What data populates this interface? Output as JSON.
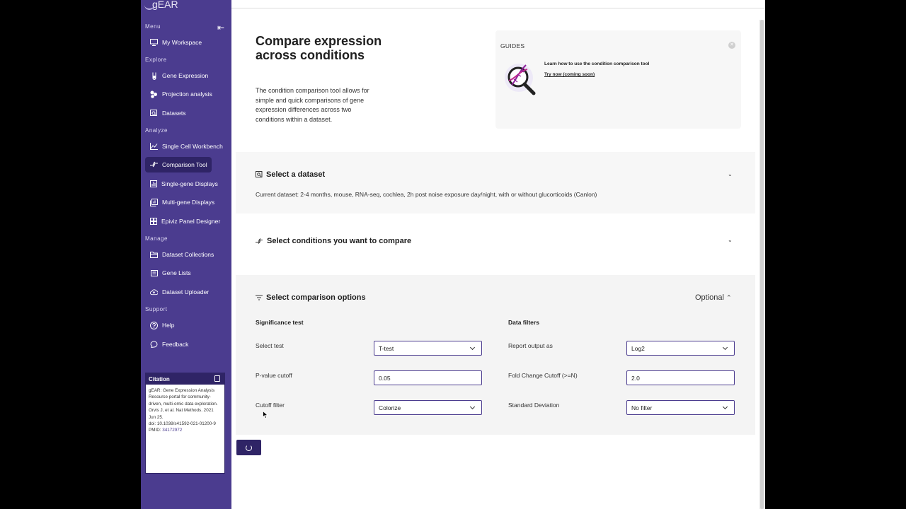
{
  "app": {
    "logo": "gEAR"
  },
  "sidebar": {
    "sections": {
      "menu": "Menu",
      "explore": "Explore",
      "analyze": "Analyze",
      "manage": "Manage",
      "support": "Support"
    },
    "items": [
      {
        "label": "My Workspace",
        "icon": "monitor-icon"
      },
      {
        "label": "Gene Expression",
        "icon": "test-tube-icon"
      },
      {
        "label": "Projection analysis",
        "icon": "circles-icon"
      },
      {
        "label": "Datasets",
        "icon": "dataset-search-icon"
      },
      {
        "label": "Single Cell Workbench",
        "icon": "line-chart-icon"
      },
      {
        "label": "Comparison Tool",
        "icon": "compare-arrows-icon"
      },
      {
        "label": "Single-gene Displays",
        "icon": "bar-chart-icon"
      },
      {
        "label": "Multi-gene Displays",
        "icon": "layers-chart-icon"
      },
      {
        "label": "Epiviz Panel Designer",
        "icon": "grid-icon"
      },
      {
        "label": "Dataset Collections",
        "icon": "folder-icon"
      },
      {
        "label": "Gene Lists",
        "icon": "list-icon"
      },
      {
        "label": "Dataset Uploader",
        "icon": "cloud-upload-icon"
      },
      {
        "label": "Help",
        "icon": "help-icon"
      },
      {
        "label": "Feedback",
        "icon": "feedback-icon"
      }
    ],
    "active_item": "Comparison Tool"
  },
  "citation": {
    "title": "Citation",
    "text1": "gEAR: Gene Expression Analysis Resource portal for community-driven, multi-omic data exploration.",
    "text2": "Orvis J, et al. Nat Methods. 2021 Jun 25.",
    "doi": "doi: 10.1038/s41592-021-01200-9",
    "pmid_label": "PMID:",
    "pmid": "34172972"
  },
  "header": {
    "title": "Compare expression across conditions",
    "description": "The condition comparison tool allows for simple and quick comparisons of gene expression differences across two conditions within a dataset."
  },
  "guides": {
    "title": "GUIDES",
    "link_text": "Learn how to use the condition comparison tool",
    "try_text": "Try now (coming soon)"
  },
  "dataset_panel": {
    "title": "Select a dataset",
    "current": "Current dataset: 2-4 months, mouse, RNA-seq, cochlea, 2h post noise exposure day/night, with or without glucorticoids (Canlon)"
  },
  "conditions_panel": {
    "title": "Select conditions you want to compare"
  },
  "options_panel": {
    "title": "Select comparison options",
    "optional_label": "Optional",
    "significance_heading": "Significance test",
    "filters_heading": "Data filters",
    "select_test_label": "Select test",
    "select_test_value": "T-test",
    "pvalue_label": "P-value cutoff",
    "pvalue_value": "0.05",
    "cutoff_filter_label": "Cutoff filter",
    "cutoff_filter_value": "Colorize",
    "report_label": "Report output as",
    "report_value": "Log2",
    "fold_change_label": "Fold Change Cutoff (>=N)",
    "fold_change_value": "2.0",
    "std_label": "Standard Deviation",
    "std_value": "No filter"
  },
  "colors": {
    "sidebar": "#4b3c8f",
    "sidebar_active": "#2f2466",
    "accent": "#4b3c8f",
    "panel_bg": "#f4f4f4"
  }
}
